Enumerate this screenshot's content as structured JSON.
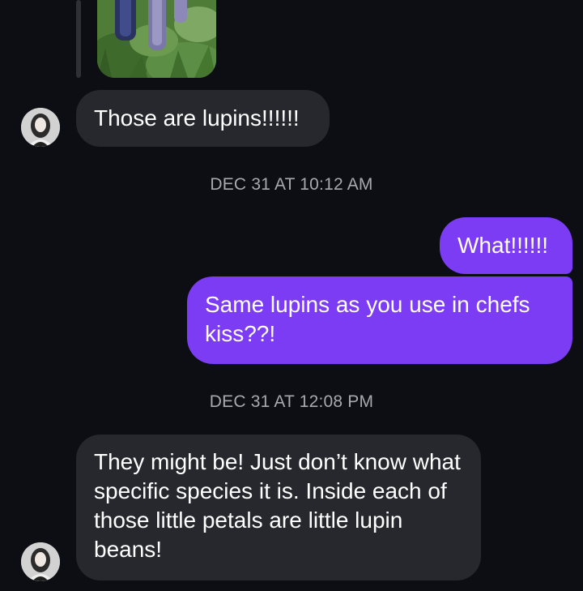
{
  "thread": {
    "messages": [
      {
        "sender": "other",
        "text": "Those are lupins!!!!!!"
      },
      {
        "sender": "me",
        "text": "What!!!!!!"
      },
      {
        "sender": "me",
        "text": "Same lupins as you use in chefs kiss??!"
      },
      {
        "sender": "other",
        "text": "They might be! Just don’t know what specific species it is. Inside each of those little petals are little lupin beans!"
      }
    ],
    "timestamps": [
      "DEC 31 AT 10:12 AM",
      "DEC 31 AT 12:08 PM"
    ]
  },
  "colors": {
    "background": "#0c0e14",
    "incoming_bubble": "#26282e",
    "outgoing_bubble": "#7b3cf4",
    "timestamp_text": "#a8a9ad"
  },
  "icons": {
    "avatar": "contact-avatar-photo",
    "photo": "lupin-flowers-photo"
  }
}
